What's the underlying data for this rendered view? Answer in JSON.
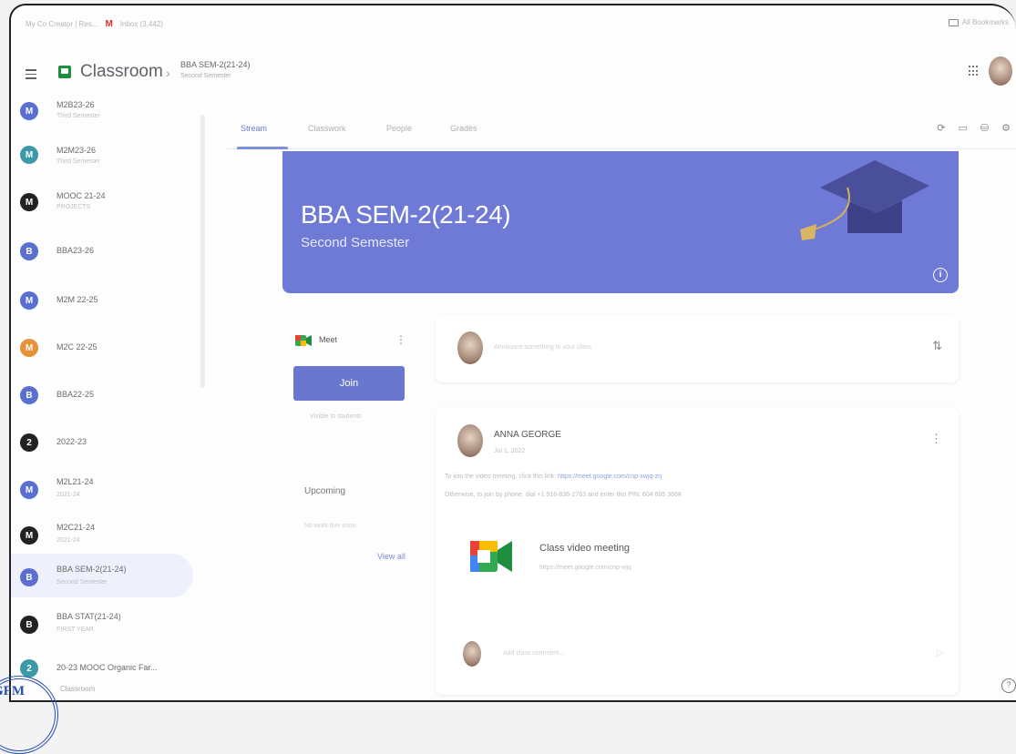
{
  "browser": {
    "bookmarks": [
      "My Co Creator | Res...",
      "Inbox (3,442)"
    ],
    "bookmark_right": "All Bookmarks"
  },
  "header": {
    "app_name": "Classroom",
    "breadcrumb_title": "BBA SEM-2(21-24)",
    "breadcrumb_sub": "Second Semester"
  },
  "sidebar": {
    "items": [
      {
        "initial": "M",
        "name": "M2B23-26",
        "sub": "Third Semester",
        "color": "#5b6fd0"
      },
      {
        "initial": "M",
        "name": "M2M23-26",
        "sub": "Third Semester",
        "color": "#3a9aa8"
      },
      {
        "initial": "M",
        "name": "MOOC 21-24",
        "sub": "PROJECTS",
        "color": "#222222"
      },
      {
        "initial": "B",
        "name": "BBA23-26",
        "sub": "",
        "color": "#5b6fd0"
      },
      {
        "initial": "M",
        "name": "M2M 22-25",
        "sub": "",
        "color": "#5b6fd0"
      },
      {
        "initial": "M",
        "name": "M2C 22-25",
        "sub": "",
        "color": "#e8903a"
      },
      {
        "initial": "B",
        "name": "BBA22-25",
        "sub": "",
        "color": "#5b6fd0"
      },
      {
        "initial": "2",
        "name": "2022-23",
        "sub": "",
        "color": "#222222"
      },
      {
        "initial": "M",
        "name": "M2L21-24",
        "sub": "2021-24",
        "color": "#5b6fd0"
      },
      {
        "initial": "M",
        "name": "M2C21-24",
        "sub": "2021-24",
        "color": "#222222"
      },
      {
        "initial": "B",
        "name": "BBA SEM-2(21-24)",
        "sub": "Second Semester",
        "color": "#5b6fd0"
      },
      {
        "initial": "B",
        "name": "BBA STAT(21-24)",
        "sub": "FIRST YEAR",
        "color": "#222222"
      },
      {
        "initial": "2",
        "name": "20-23 MOOC Organic Far...",
        "sub": "",
        "color": "#3a9aa8"
      }
    ]
  },
  "tabs": [
    "Stream",
    "Classwork",
    "People",
    "Grades"
  ],
  "banner": {
    "title": "BBA SEM-2(21-24)",
    "subtitle": "Second Semester",
    "color": "#6f79d6"
  },
  "meet": {
    "label": "Meet",
    "join_label": "Join",
    "note": "Visible to students"
  },
  "upcoming": {
    "title": "Upcoming",
    "body": "No work due soon",
    "view_all": "View all"
  },
  "announce": {
    "placeholder": "Announce something to your class"
  },
  "post": {
    "author": "ANNA GEORGE",
    "date": "Jul 1, 2022",
    "line1_prefix": "To join the video meeting, click this link:",
    "line1_link": "https://meet.google.com/cnp-xwjq-zrj",
    "line2": "Otherwise, to join by phone, dial +1 916-836-2763 and enter this PIN: 604 605 366#",
    "attachment_title": "Class video meeting",
    "attachment_url": "https://meet.google.com/cnp-wjq",
    "comment_placeholder": "Add class comment..."
  },
  "stamp": {
    "text": "GFM",
    "footer": "Classroom"
  },
  "colors": {
    "accent": "#6977cf",
    "banner": "#6f79d6",
    "link": "#8ea0e8"
  }
}
